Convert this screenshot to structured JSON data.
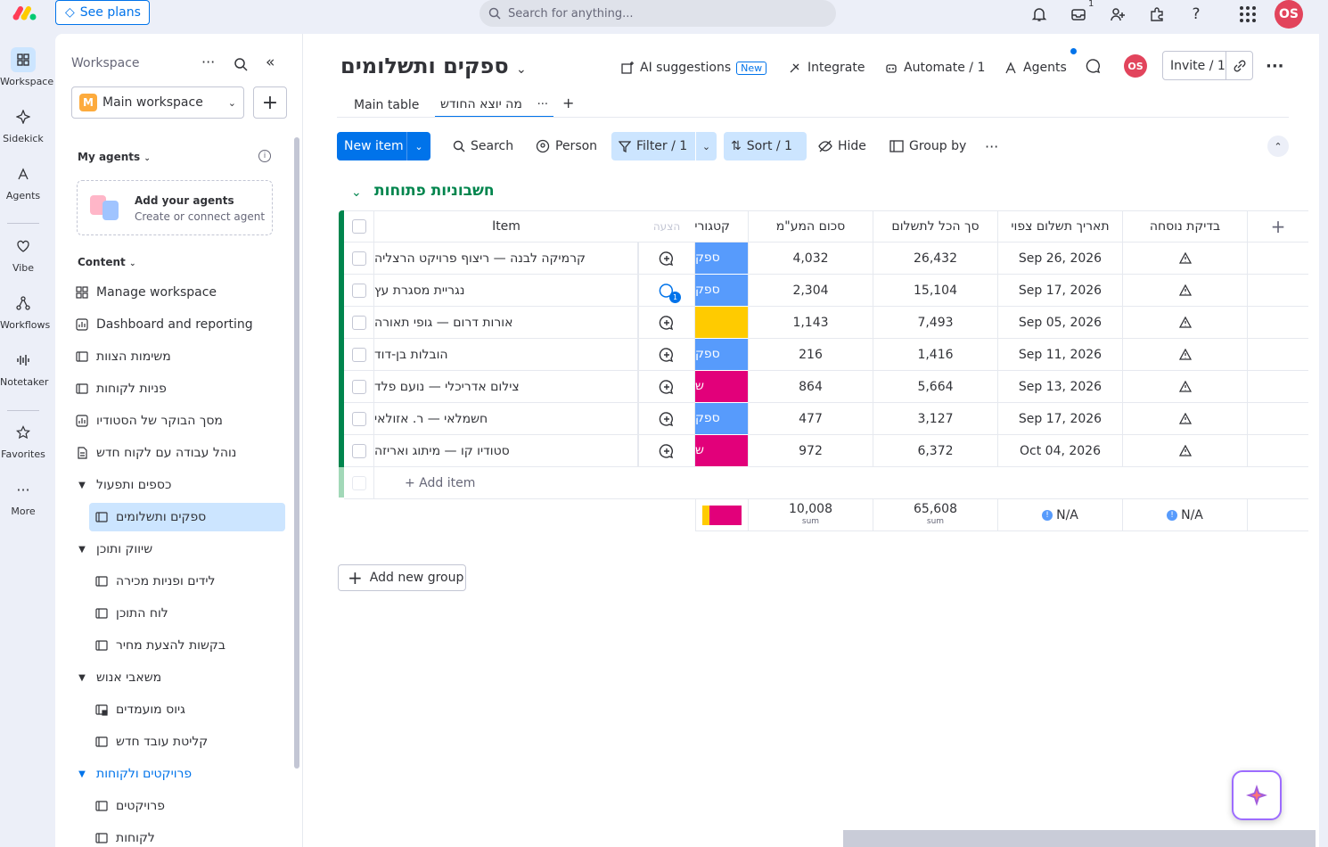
{
  "topbar": {
    "see_plans": "See plans",
    "search_placeholder": "Search for anything...",
    "inbox_count": "1",
    "user_initials": "OS"
  },
  "rail": [
    {
      "label": "Workspace",
      "icon": "grid-icon"
    },
    {
      "label": "Sidekick",
      "icon": "sparkle-icon"
    },
    {
      "label": "Agents",
      "icon": "agent-icon"
    },
    {
      "label": "Vibe",
      "icon": "heart-icon"
    },
    {
      "label": "Workflows",
      "icon": "workflow-icon"
    },
    {
      "label": "Notetaker",
      "icon": "waveform-icon"
    },
    {
      "label": "Favorites",
      "icon": "star-icon"
    },
    {
      "label": "More",
      "icon": "more-icon"
    }
  ],
  "sidebar": {
    "title": "Workspace",
    "workspace_name": "Main workspace",
    "workspace_initial": "M",
    "my_agents": "My agents",
    "agent_card_title": "Add your agents",
    "agent_card_sub": "Create or connect agent",
    "content": "Content",
    "items": [
      {
        "label": "Manage workspace",
        "kind": "link",
        "icon": "workspace-icon"
      },
      {
        "label": "Dashboard and reporting",
        "kind": "link",
        "icon": "dashboard-icon"
      },
      {
        "label": "משימות הצוות",
        "kind": "board",
        "icon": "board-icon"
      },
      {
        "label": "פניות לקוחות",
        "kind": "board",
        "icon": "board-icon"
      },
      {
        "label": "מסך הבוקר של הסטודיו",
        "kind": "dashboard",
        "icon": "dashboard-icon"
      },
      {
        "label": "נוהל עבודה עם לקוח חדש",
        "kind": "doc",
        "icon": "doc-icon"
      },
      {
        "label": "כספים ותפעול",
        "kind": "folder"
      },
      {
        "label": "ספקים ותשלומים",
        "kind": "board",
        "icon": "board-icon",
        "active": true
      },
      {
        "label": "שיווק ותוכן",
        "kind": "folder"
      },
      {
        "label": "לידים ופניות מכירה",
        "kind": "board",
        "icon": "board-icon"
      },
      {
        "label": "לוח התוכן",
        "kind": "board",
        "icon": "board-icon"
      },
      {
        "label": "בקשות להצעת מחיר",
        "kind": "board",
        "icon": "board-icon"
      },
      {
        "label": "משאבי אנוש",
        "kind": "folder"
      },
      {
        "label": "גיוס מועמדים",
        "kind": "board-locked",
        "icon": "locked-board-icon"
      },
      {
        "label": "קליטת עובד חדש",
        "kind": "board",
        "icon": "board-icon"
      },
      {
        "label": "פרויקטים ולקוחות",
        "kind": "folder",
        "blue": true
      },
      {
        "label": "פרויקטים",
        "kind": "board",
        "icon": "board-icon"
      },
      {
        "label": "לקוחות",
        "kind": "board",
        "icon": "board-icon"
      }
    ]
  },
  "board": {
    "title": "ספקים ותשלומים",
    "ai_suggestions": "AI suggestions",
    "new_tag": "New",
    "integrate": "Integrate",
    "automate": "Automate / 1",
    "agents": "Agents",
    "avatar": "OS",
    "invite": "Invite / 1",
    "tabs": [
      "Main table",
      "מה יוצא החודש"
    ],
    "toolbar": {
      "new_item": "New item",
      "search": "Search",
      "person": "Person",
      "filter": "Filter / 1",
      "sort": "Sort / 1",
      "hide": "Hide",
      "group_by": "Group by"
    },
    "group_title": "חשבוניות פתוחות",
    "columns": {
      "item": "Item",
      "updates": "הצעה",
      "category": "קטגוריה",
      "amount": "סכום המע\"מ",
      "total": "סך הכל לתשלום",
      "due": "תאריך תשלום צפוי",
      "formula": "בדיקת נוסחה"
    },
    "rows": [
      {
        "item": "קרמיקה לבנה — ריצוף פרויקט הרצליה",
        "cat_label": "ספק",
        "cat_color": "#579bfc",
        "amount": "4,032",
        "total": "26,432",
        "due": "Sep 26, 2026",
        "updates": ""
      },
      {
        "item": "נגריית מסגרת עץ",
        "cat_label": "ספק",
        "cat_color": "#579bfc",
        "amount": "2,304",
        "total": "15,104",
        "due": "Sep 17, 2026",
        "updates": "1"
      },
      {
        "item": "אורות דרום — גופי תאורה",
        "cat_label": "",
        "cat_color": "#ffcb00",
        "amount": "1,143",
        "total": "7,493",
        "due": "Sep 05, 2026",
        "updates": ""
      },
      {
        "item": "הובלות בן-דוד",
        "cat_label": "ספק",
        "cat_color": "#579bfc",
        "amount": "216",
        "total": "1,416",
        "due": "Sep 11, 2026",
        "updates": ""
      },
      {
        "item": "צילום אדריכלי — נועם פלד",
        "cat_label": "ש",
        "cat_color": "#e2007a",
        "amount": "864",
        "total": "5,664",
        "due": "Sep 13, 2026",
        "updates": ""
      },
      {
        "item": "חשמלאי — ר. אזולאי",
        "cat_label": "ספק",
        "cat_color": "#579bfc",
        "amount": "477",
        "total": "3,127",
        "due": "Sep 17, 2026",
        "updates": ""
      },
      {
        "item": "סטודיו קו — מיתוג ואריזה",
        "cat_label": "ש",
        "cat_color": "#e2007a",
        "amount": "972",
        "total": "6,372",
        "due": "Oct 04, 2026",
        "updates": ""
      }
    ],
    "add_item": "+ Add item",
    "summary": {
      "amount": "10,008",
      "total": "65,608",
      "sum_label": "sum",
      "due": "N/A",
      "formula": "N/A"
    },
    "add_new_group": "Add new group"
  }
}
